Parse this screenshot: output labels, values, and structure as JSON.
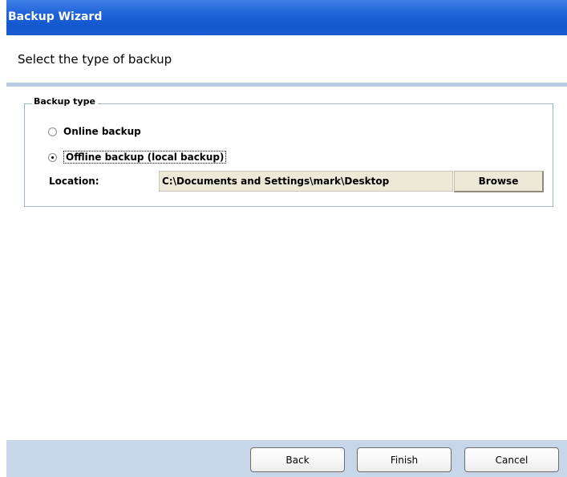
{
  "window": {
    "title": "Backup Wizard"
  },
  "header": {
    "title": "Select the type of backup"
  },
  "backup_type": {
    "legend": "Backup type",
    "options": [
      {
        "label": "Online backup",
        "checked": false
      },
      {
        "label": "Offline backup (local backup)",
        "checked": true
      }
    ],
    "location_label": "Location:",
    "location_value": "C:\\Documents and Settings\\mark\\Desktop",
    "browse_label": "Browse"
  },
  "footer": {
    "back_label": "Back",
    "finish_label": "Finish",
    "cancel_label": "Cancel"
  },
  "colors": {
    "titlebar": "#1e63d8",
    "panel_border": "#9db2d1",
    "footer_bg": "#c8d6ea"
  }
}
